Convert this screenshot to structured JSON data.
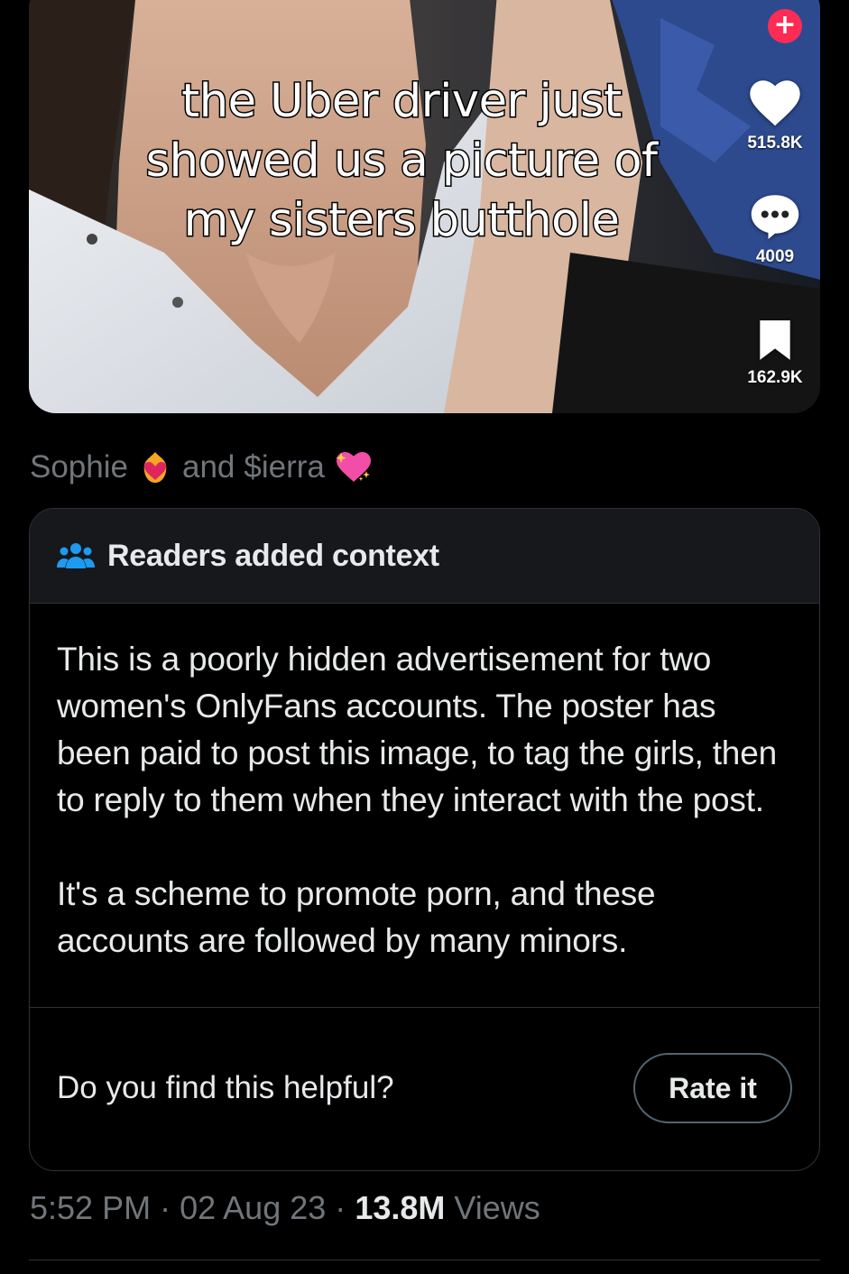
{
  "media": {
    "caption_lines": [
      "the Uber driver just",
      "showed us a picture of",
      "my sisters butthole"
    ],
    "sidebar": {
      "plus_symbol": "+",
      "likes": "515.8K",
      "comments": "4009",
      "saves": "162.9K"
    }
  },
  "tags": {
    "first": "Sophie",
    "joiner": "and",
    "second": "$ierra"
  },
  "note": {
    "title": "Readers added context",
    "paragraphs": [
      "This is a poorly hidden advertisement for two women's OnlyFans accounts. The poster has been paid to post this image, to tag the girls, then to reply to them when they interact with the post.",
      "It's a scheme to promote porn, and these accounts are followed by many minors."
    ],
    "helpful_question": "Do you find this helpful?",
    "rate_label": "Rate it"
  },
  "meta": {
    "time": "5:52 PM",
    "sep1": "·",
    "date": "02 Aug 23",
    "sep2": "·",
    "views_count": "13.8M",
    "views_label": "Views"
  },
  "colors": {
    "background": "#000000",
    "card_header": "#16181c",
    "border": "#2f3336",
    "muted_text": "#71767b",
    "primary_text": "#e7e9ea",
    "note_icon": "#1d9bf0",
    "tiktok_plus": "#fe2c55"
  }
}
